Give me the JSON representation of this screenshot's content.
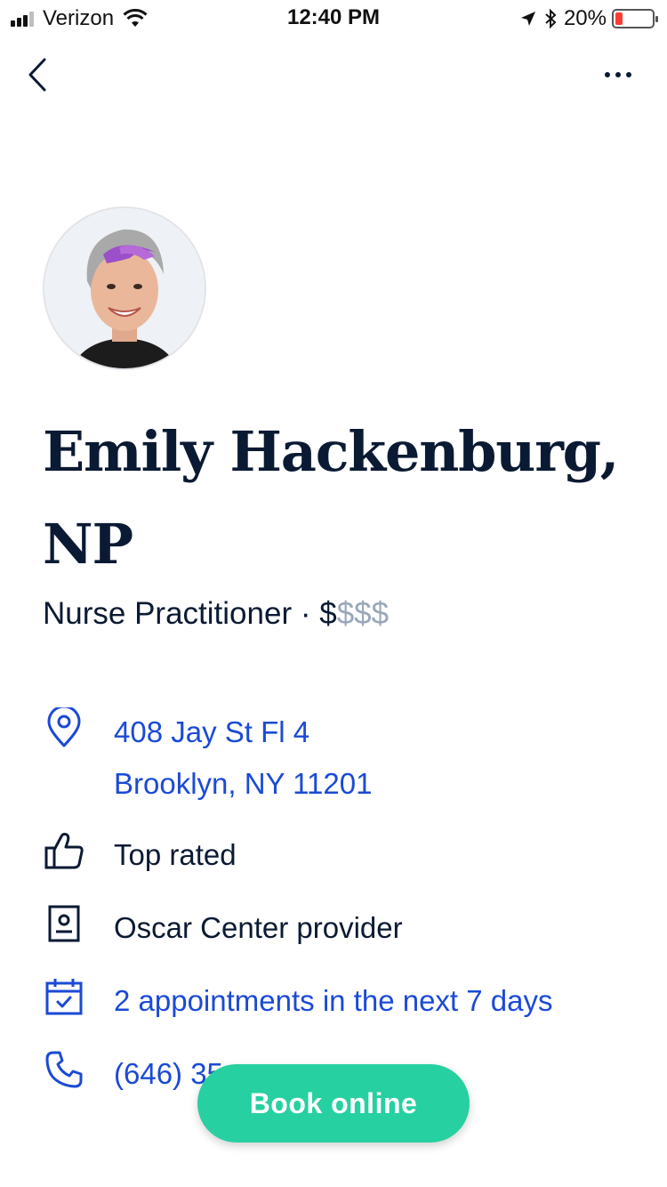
{
  "status_bar": {
    "carrier": "Verizon",
    "time": "12:40 PM",
    "battery_percent": "20%",
    "battery_level": 0.2
  },
  "nav": {
    "back_icon": "chevron-left-icon",
    "more_icon": "more-horizontal-icon"
  },
  "provider": {
    "name": "Emily Hackenburg, NP",
    "title": "Nurse Practitioner · ",
    "price_active": "$",
    "price_inactive": "$$$"
  },
  "details": {
    "address_line1": "408 Jay St Fl 4",
    "address_line2": "Brooklyn, NY 11201",
    "rating": "Top rated",
    "center": "Oscar Center provider",
    "appointments": "2 appointments in the next 7 days",
    "phone": "(646) 35"
  },
  "actions": {
    "book_label": "Book online"
  },
  "colors": {
    "accent_blue": "#1b4ad6",
    "navy": "#0b1a33",
    "book_green": "#27d0a1"
  }
}
